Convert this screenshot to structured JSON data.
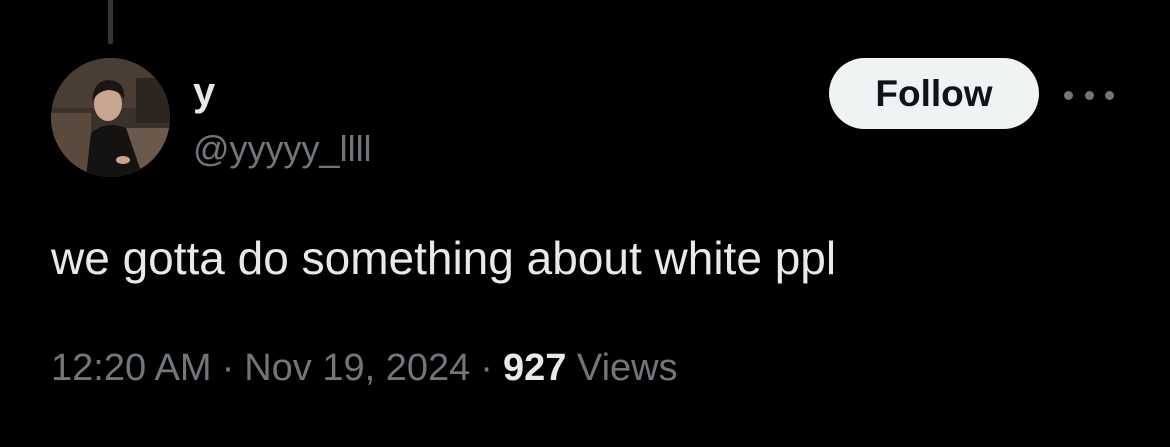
{
  "tweet": {
    "author": {
      "display_name": "y",
      "handle": "@yyyyy_llll"
    },
    "follow_label": "Follow",
    "more_icon": "more-horizontal-icon",
    "text": "we gotta do something about white ppl",
    "time": "12:20 AM",
    "separator": "·",
    "date": "Nov 19, 2024",
    "views_count": "927",
    "views_label": "Views"
  },
  "colors": {
    "background": "#000000",
    "primary_text": "#e7e9ea",
    "secondary_text": "#71767b",
    "follow_bg": "#eff3f4",
    "follow_text": "#0f1419"
  }
}
